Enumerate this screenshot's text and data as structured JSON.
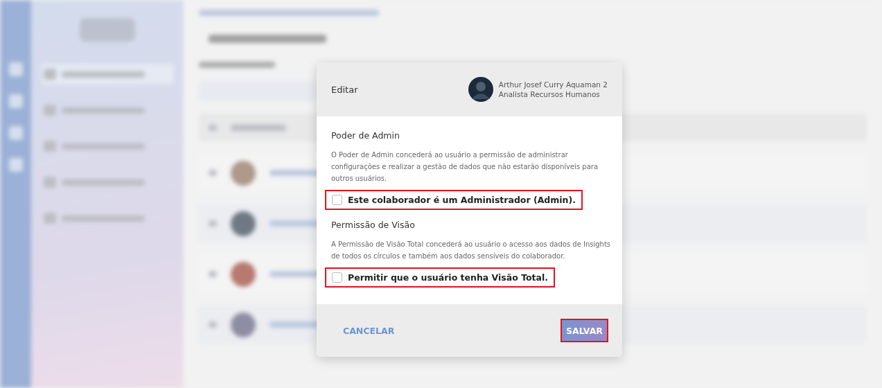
{
  "modal": {
    "title": "Editar",
    "user": {
      "name": "Arthur Josef Curry Aquaman 2",
      "role": "Analista Recursos Humanos"
    },
    "sections": [
      {
        "title": "Poder de Admin",
        "description": "O Poder de Admin concederá ao usuário a permissão de administrar configurações e realizar a gestão de dados que não estarão disponíveis para outros usuários.",
        "option": {
          "label": "Este colaborador é um Administrador (Admin).",
          "checked": false,
          "highlighted": true
        }
      },
      {
        "title": "Permissão de Visão",
        "description": "A Permissão de Visão Total concederá ao usuário o acesso aos dados de Insights de todos os círculos e também aos dados sensíveis do colaborador.",
        "option": {
          "label": "Permitir que o usuário tenha Visão Total.",
          "checked": false,
          "highlighted": true
        }
      }
    ],
    "buttons": [
      {
        "label": "CANCELAR",
        "kind": "text",
        "highlighted": false
      },
      {
        "label": "SALVAR",
        "kind": "primary",
        "highlighted": true
      }
    ]
  }
}
